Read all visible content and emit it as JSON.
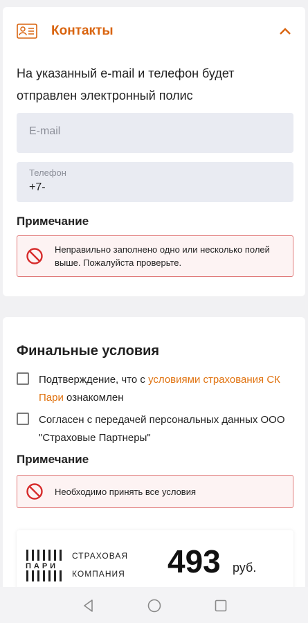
{
  "contacts": {
    "title": "Контакты",
    "icon": "contact-card-icon",
    "intro": "На указанный e-mail и телефон будет отправлен электронный полис",
    "email_placeholder": "E-mail",
    "phone_label": "Телефон",
    "phone_value": "+7-",
    "note_label": "Примечание",
    "alert": "Неправильно заполнено одно или несколько полей выше. Пожалуйста проверьте."
  },
  "final": {
    "title": "Финальные условия",
    "check1_prefix": "Подтверждение, что с",
    "check1_link": "условиями страхования СК Пари",
    "check1_suffix": "ознакомлен",
    "check2": "Согласен с передачей персональных данных ООО \"Страховые Партнеры\"",
    "note_label": "Примечание",
    "alert": "Необходимо принять все условия"
  },
  "price_card": {
    "logo_word": "ПАРИ",
    "company_line1": "СТРАХОВАЯ",
    "company_line2": "КОМПАНИЯ",
    "price": "493",
    "currency": "руб."
  },
  "colors": {
    "accent": "#d9640f",
    "link": "#e0720f",
    "error_border": "#e07a7a",
    "error_icon": "#d62b2b",
    "field_bg": "#e9ebf2"
  }
}
